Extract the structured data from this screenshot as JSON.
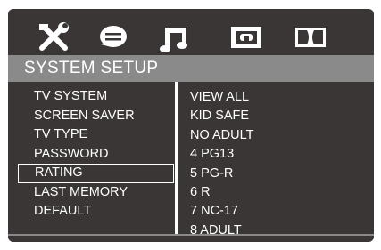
{
  "tabs": [
    {
      "icon": "tools-icon"
    },
    {
      "icon": "speech-bubble-icon"
    },
    {
      "icon": "music-note-icon"
    },
    {
      "icon": "tv-screen-icon"
    },
    {
      "icon": "dolby-icon"
    }
  ],
  "header": {
    "title": "SYSTEM SETUP"
  },
  "menu": {
    "items": [
      "TV SYSTEM",
      "SCREEN SAVER",
      "TV TYPE",
      "PASSWORD",
      "RATING",
      "LAST MEMORY",
      "DEFAULT"
    ],
    "selected": "RATING"
  },
  "options": [
    "VIEW ALL",
    "KID SAFE",
    "NO ADULT",
    "4  PG13",
    "5  PG-R",
    "6  R",
    "7  NC-17",
    "8  ADULT"
  ],
  "colors": {
    "background": "#3b3636",
    "title_bar": "#8a8a8a",
    "text": "#ffffff"
  }
}
